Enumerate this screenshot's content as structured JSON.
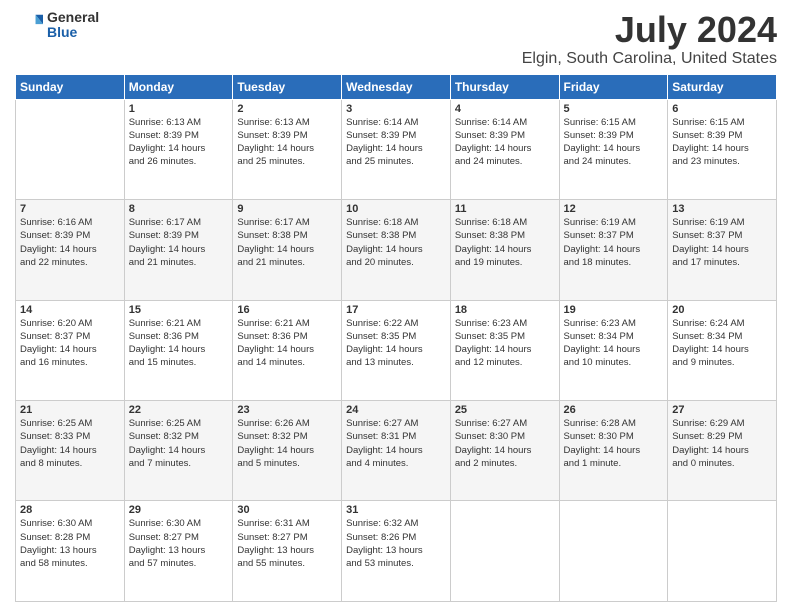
{
  "logo": {
    "general": "General",
    "blue": "Blue"
  },
  "title": "July 2024",
  "subtitle": "Elgin, South Carolina, United States",
  "headers": [
    "Sunday",
    "Monday",
    "Tuesday",
    "Wednesday",
    "Thursday",
    "Friday",
    "Saturday"
  ],
  "weeks": [
    [
      {
        "day": "",
        "info": ""
      },
      {
        "day": "1",
        "info": "Sunrise: 6:13 AM\nSunset: 8:39 PM\nDaylight: 14 hours\nand 26 minutes."
      },
      {
        "day": "2",
        "info": "Sunrise: 6:13 AM\nSunset: 8:39 PM\nDaylight: 14 hours\nand 25 minutes."
      },
      {
        "day": "3",
        "info": "Sunrise: 6:14 AM\nSunset: 8:39 PM\nDaylight: 14 hours\nand 25 minutes."
      },
      {
        "day": "4",
        "info": "Sunrise: 6:14 AM\nSunset: 8:39 PM\nDaylight: 14 hours\nand 24 minutes."
      },
      {
        "day": "5",
        "info": "Sunrise: 6:15 AM\nSunset: 8:39 PM\nDaylight: 14 hours\nand 24 minutes."
      },
      {
        "day": "6",
        "info": "Sunrise: 6:15 AM\nSunset: 8:39 PM\nDaylight: 14 hours\nand 23 minutes."
      }
    ],
    [
      {
        "day": "7",
        "info": "Sunrise: 6:16 AM\nSunset: 8:39 PM\nDaylight: 14 hours\nand 22 minutes."
      },
      {
        "day": "8",
        "info": "Sunrise: 6:17 AM\nSunset: 8:39 PM\nDaylight: 14 hours\nand 21 minutes."
      },
      {
        "day": "9",
        "info": "Sunrise: 6:17 AM\nSunset: 8:38 PM\nDaylight: 14 hours\nand 21 minutes."
      },
      {
        "day": "10",
        "info": "Sunrise: 6:18 AM\nSunset: 8:38 PM\nDaylight: 14 hours\nand 20 minutes."
      },
      {
        "day": "11",
        "info": "Sunrise: 6:18 AM\nSunset: 8:38 PM\nDaylight: 14 hours\nand 19 minutes."
      },
      {
        "day": "12",
        "info": "Sunrise: 6:19 AM\nSunset: 8:37 PM\nDaylight: 14 hours\nand 18 minutes."
      },
      {
        "day": "13",
        "info": "Sunrise: 6:19 AM\nSunset: 8:37 PM\nDaylight: 14 hours\nand 17 minutes."
      }
    ],
    [
      {
        "day": "14",
        "info": "Sunrise: 6:20 AM\nSunset: 8:37 PM\nDaylight: 14 hours\nand 16 minutes."
      },
      {
        "day": "15",
        "info": "Sunrise: 6:21 AM\nSunset: 8:36 PM\nDaylight: 14 hours\nand 15 minutes."
      },
      {
        "day": "16",
        "info": "Sunrise: 6:21 AM\nSunset: 8:36 PM\nDaylight: 14 hours\nand 14 minutes."
      },
      {
        "day": "17",
        "info": "Sunrise: 6:22 AM\nSunset: 8:35 PM\nDaylight: 14 hours\nand 13 minutes."
      },
      {
        "day": "18",
        "info": "Sunrise: 6:23 AM\nSunset: 8:35 PM\nDaylight: 14 hours\nand 12 minutes."
      },
      {
        "day": "19",
        "info": "Sunrise: 6:23 AM\nSunset: 8:34 PM\nDaylight: 14 hours\nand 10 minutes."
      },
      {
        "day": "20",
        "info": "Sunrise: 6:24 AM\nSunset: 8:34 PM\nDaylight: 14 hours\nand 9 minutes."
      }
    ],
    [
      {
        "day": "21",
        "info": "Sunrise: 6:25 AM\nSunset: 8:33 PM\nDaylight: 14 hours\nand 8 minutes."
      },
      {
        "day": "22",
        "info": "Sunrise: 6:25 AM\nSunset: 8:32 PM\nDaylight: 14 hours\nand 7 minutes."
      },
      {
        "day": "23",
        "info": "Sunrise: 6:26 AM\nSunset: 8:32 PM\nDaylight: 14 hours\nand 5 minutes."
      },
      {
        "day": "24",
        "info": "Sunrise: 6:27 AM\nSunset: 8:31 PM\nDaylight: 14 hours\nand 4 minutes."
      },
      {
        "day": "25",
        "info": "Sunrise: 6:27 AM\nSunset: 8:30 PM\nDaylight: 14 hours\nand 2 minutes."
      },
      {
        "day": "26",
        "info": "Sunrise: 6:28 AM\nSunset: 8:30 PM\nDaylight: 14 hours\nand 1 minute."
      },
      {
        "day": "27",
        "info": "Sunrise: 6:29 AM\nSunset: 8:29 PM\nDaylight: 14 hours\nand 0 minutes."
      }
    ],
    [
      {
        "day": "28",
        "info": "Sunrise: 6:30 AM\nSunset: 8:28 PM\nDaylight: 13 hours\nand 58 minutes."
      },
      {
        "day": "29",
        "info": "Sunrise: 6:30 AM\nSunset: 8:27 PM\nDaylight: 13 hours\nand 57 minutes."
      },
      {
        "day": "30",
        "info": "Sunrise: 6:31 AM\nSunset: 8:27 PM\nDaylight: 13 hours\nand 55 minutes."
      },
      {
        "day": "31",
        "info": "Sunrise: 6:32 AM\nSunset: 8:26 PM\nDaylight: 13 hours\nand 53 minutes."
      },
      {
        "day": "",
        "info": ""
      },
      {
        "day": "",
        "info": ""
      },
      {
        "day": "",
        "info": ""
      }
    ]
  ]
}
